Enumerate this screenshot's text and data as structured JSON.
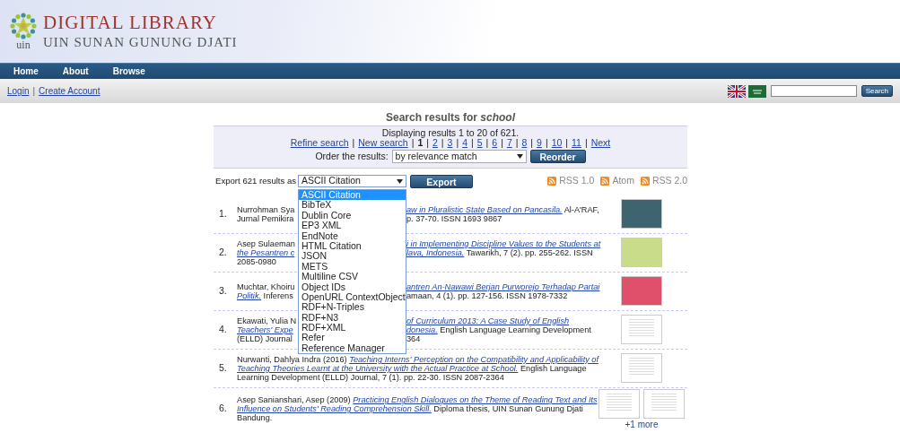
{
  "header": {
    "title": "DIGITAL LIBRARY",
    "subtitle": "UIN SUNAN GUNUNG DJATI",
    "logo_text": "uin"
  },
  "nav": [
    "Home",
    "About",
    "Browse"
  ],
  "user_bar": {
    "links": [
      "Login",
      "Create Account"
    ],
    "separator": "|",
    "search_button": "Search"
  },
  "heading": {
    "text": "Search results for ",
    "query": "school"
  },
  "paging": {
    "summary": "Displaying results 1 to 20 of 621.",
    "separator": "|",
    "links": [
      {
        "label": "Refine search",
        "selected": false
      },
      {
        "label": "New search",
        "selected": false
      },
      {
        "label": "1",
        "selected": true
      },
      {
        "label": "2",
        "selected": false
      },
      {
        "label": "3",
        "selected": false
      },
      {
        "label": "4",
        "selected": false
      },
      {
        "label": "5",
        "selected": false
      },
      {
        "label": "6",
        "selected": false
      },
      {
        "label": "7",
        "selected": false
      },
      {
        "label": "8",
        "selected": false
      },
      {
        "label": "9",
        "selected": false
      },
      {
        "label": "10",
        "selected": false
      },
      {
        "label": "11",
        "selected": false
      },
      {
        "label": "Next",
        "selected": false
      }
    ],
    "order_label": "Order the results:",
    "order_value": "by relevance match",
    "order_button": "Reorder"
  },
  "export": {
    "label": "Export 621 results as",
    "value": "ASCII Citation",
    "button": "Export",
    "options": [
      {
        "label": "ASCII Citation",
        "selected": true
      },
      {
        "label": "BibTeX",
        "selected": false
      },
      {
        "label": "Dublin Core",
        "selected": false
      },
      {
        "label": "EP3 XML",
        "selected": false
      },
      {
        "label": "EndNote",
        "selected": false
      },
      {
        "label": "HTML Citation",
        "selected": false
      },
      {
        "label": "JSON",
        "selected": false
      },
      {
        "label": "METS",
        "selected": false
      },
      {
        "label": "Multiline CSV",
        "selected": false
      },
      {
        "label": "Object IDs",
        "selected": false
      },
      {
        "label": "OpenURL ContextObject",
        "selected": false
      },
      {
        "label": "RDF+N-Triples",
        "selected": false
      },
      {
        "label": "RDF+N3",
        "selected": false
      },
      {
        "label": "RDF+XML",
        "selected": false
      },
      {
        "label": "Refer",
        "selected": false
      },
      {
        "label": "Reference Manager",
        "selected": false
      }
    ],
    "feeds": [
      "RSS 1.0",
      "Atom",
      "RSS 2.0"
    ]
  },
  "results": [
    {
      "number": "1.",
      "lines": [
        [
          [
            {
              "kind": "plain",
              "text": "Nurrohman Sya"
            }
          ],
          [
            {
              "kind": "link",
              "text": "aw in Pluralistic State Based on Pancasila."
            },
            {
              "kind": "plain",
              "text": " Al-A'RAF,"
            }
          ]
        ],
        [
          [
            {
              "kind": "plain",
              "text": "Jurnal Pemikira"
            }
          ],
          [
            {
              "kind": "plain",
              "text": "p. 37-70. ISSN 1693 9867"
            }
          ]
        ]
      ],
      "thumbnails": [
        {
          "kind": "cover",
          "color": "#3e6470"
        }
      ]
    },
    {
      "number": "2.",
      "lines": [
        [
          [
            {
              "kind": "plain",
              "text": "Asep Sulaeman"
            }
          ],
          [
            {
              "kind": "link",
              "text": "i in Implementing Discipline Values to the Students at"
            }
          ]
        ],
        [
          [
            {
              "kind": "link",
              "text": "the Pesantren c"
            }
          ],
          [
            {
              "kind": "link",
              "text": "lava, Indonesia."
            },
            {
              "kind": "plain",
              "text": " Tawarikh, 7 (2). pp. 255-262. ISSN"
            }
          ]
        ],
        [
          [
            {
              "kind": "plain",
              "text": "2085-0980"
            }
          ]
        ]
      ],
      "thumbnails": [
        {
          "kind": "cover",
          "color": "#c9dc8a"
        }
      ]
    },
    {
      "number": "3.",
      "lines": [
        [
          [
            {
              "kind": "plain",
              "text": "Muchtar, Khoiru"
            }
          ],
          [
            {
              "kind": "link",
              "text": "antren An-Nawawi Berjan Purworejo Terhadap Partai"
            }
          ]
        ],
        [
          [
            {
              "kind": "link",
              "text": "Politik."
            },
            {
              "kind": "plain",
              "text": " Inferens"
            }
          ],
          [
            {
              "kind": "plain",
              "text": "amaan, 4 (1). pp. 127-156. ISSN 1978-7332"
            }
          ]
        ]
      ],
      "thumbnails": [
        {
          "kind": "cover",
          "color": "#e0506a"
        }
      ]
    },
    {
      "number": "4.",
      "lines": [
        [
          [
            {
              "kind": "plain",
              "text": "Ekawati, Yulia N"
            }
          ],
          [
            {
              "kind": "link",
              "text": "of Curriculum 2013: A Case Study of English"
            }
          ]
        ],
        [
          [
            {
              "kind": "link",
              "text": "Teachers' Expe"
            }
          ],
          [
            {
              "kind": "link",
              "text": "donesia."
            },
            {
              "kind": "plain",
              "text": " English Language Learning Development"
            }
          ]
        ],
        [
          [
            {
              "kind": "plain",
              "text": "(ELLD) Journal"
            }
          ],
          [
            {
              "kind": "plain",
              "text": "364"
            }
          ]
        ]
      ],
      "thumbnails": [
        {
          "kind": "document"
        }
      ]
    },
    {
      "number": "5.",
      "lines": [
        [
          [
            {
              "kind": "plain",
              "text": "Nurwanti, Dahlya Indra (2016) "
            },
            {
              "kind": "link",
              "text": "Teaching Interns' Perception on the Compatibility and Applicability of"
            }
          ]
        ],
        [
          [
            {
              "kind": "link",
              "text": "Teaching Theories Learnt at the University with the Actual Practice at School."
            },
            {
              "kind": "plain",
              "text": " English Language"
            }
          ]
        ],
        [
          [
            {
              "kind": "plain",
              "text": "Learning Development (ELLD) Journal, 7 (1). pp. 22-30. ISSN 2087-2364"
            }
          ]
        ]
      ],
      "thumbnails": [
        {
          "kind": "document"
        }
      ]
    },
    {
      "number": "6.",
      "lines": [
        [
          [
            {
              "kind": "plain",
              "text": "Asep Sanianshari, Asep (2009) "
            },
            {
              "kind": "link",
              "text": "Practicing English Dialogues on the Theme of Reading Text and Its"
            }
          ]
        ],
        [
          [
            {
              "kind": "link",
              "text": "Influence on Students' Reading Comprehension Skill."
            },
            {
              "kind": "plain",
              "text": " Diploma thesis, UIN Sunan Gunung Djati"
            }
          ]
        ],
        [
          [
            {
              "kind": "plain",
              "text": "Bandung."
            }
          ]
        ]
      ],
      "thumbnails": [
        {
          "kind": "document"
        },
        {
          "kind": "document"
        }
      ],
      "more": "+1 more"
    }
  ]
}
